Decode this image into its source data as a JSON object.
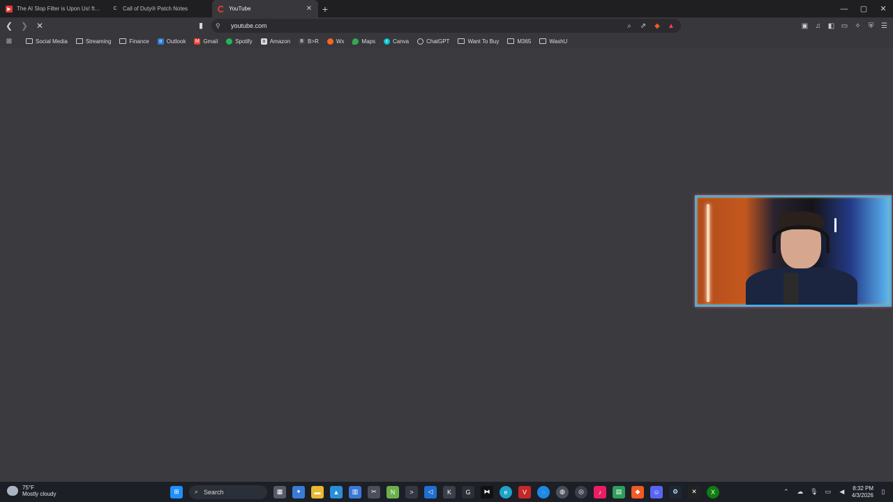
{
  "tabs": [
    {
      "title": "The AI Slop Filter is Upon Us! ft. @Da",
      "favicon": "youtube-icon",
      "color": "#e53935"
    },
    {
      "title": "Call of Duty® Patch Notes",
      "favicon": "cod-icon",
      "color": "#cfcfd2"
    },
    {
      "title": "YouTube",
      "favicon": "loading-icon",
      "color": "#e53935"
    }
  ],
  "toolbar": {
    "url": "youtube.com"
  },
  "bookmarks": [
    {
      "label": "Social Media",
      "type": "folder"
    },
    {
      "label": "Streaming",
      "type": "folder"
    },
    {
      "label": "Finance",
      "type": "folder"
    },
    {
      "label": "Outlook",
      "type": "site",
      "color": "#2b7cd3"
    },
    {
      "label": "Gmail",
      "type": "site",
      "color": "#ea4335"
    },
    {
      "label": "Spotify",
      "type": "site",
      "color": "#1db954"
    },
    {
      "label": "Amazon",
      "type": "site",
      "color": "#dddddd"
    },
    {
      "label": "B>R",
      "type": "site",
      "color": "#444444"
    },
    {
      "label": "Wx",
      "type": "site",
      "color": "#f26a21"
    },
    {
      "label": "Maps",
      "type": "site",
      "color": "#34a853"
    },
    {
      "label": "Canva",
      "type": "site",
      "color": "#00c4cc"
    },
    {
      "label": "ChatGPT",
      "type": "site",
      "color": "#cccccc"
    },
    {
      "label": "Want To Buy",
      "type": "folder"
    },
    {
      "label": "M365",
      "type": "folder"
    },
    {
      "label": "WashU",
      "type": "folder"
    }
  ],
  "taskbar": {
    "weather_temp": "75°F",
    "weather_desc": "Mostly cloudy",
    "search_label": "Search",
    "time": "8:32 PM",
    "date": "4/3/2026"
  }
}
